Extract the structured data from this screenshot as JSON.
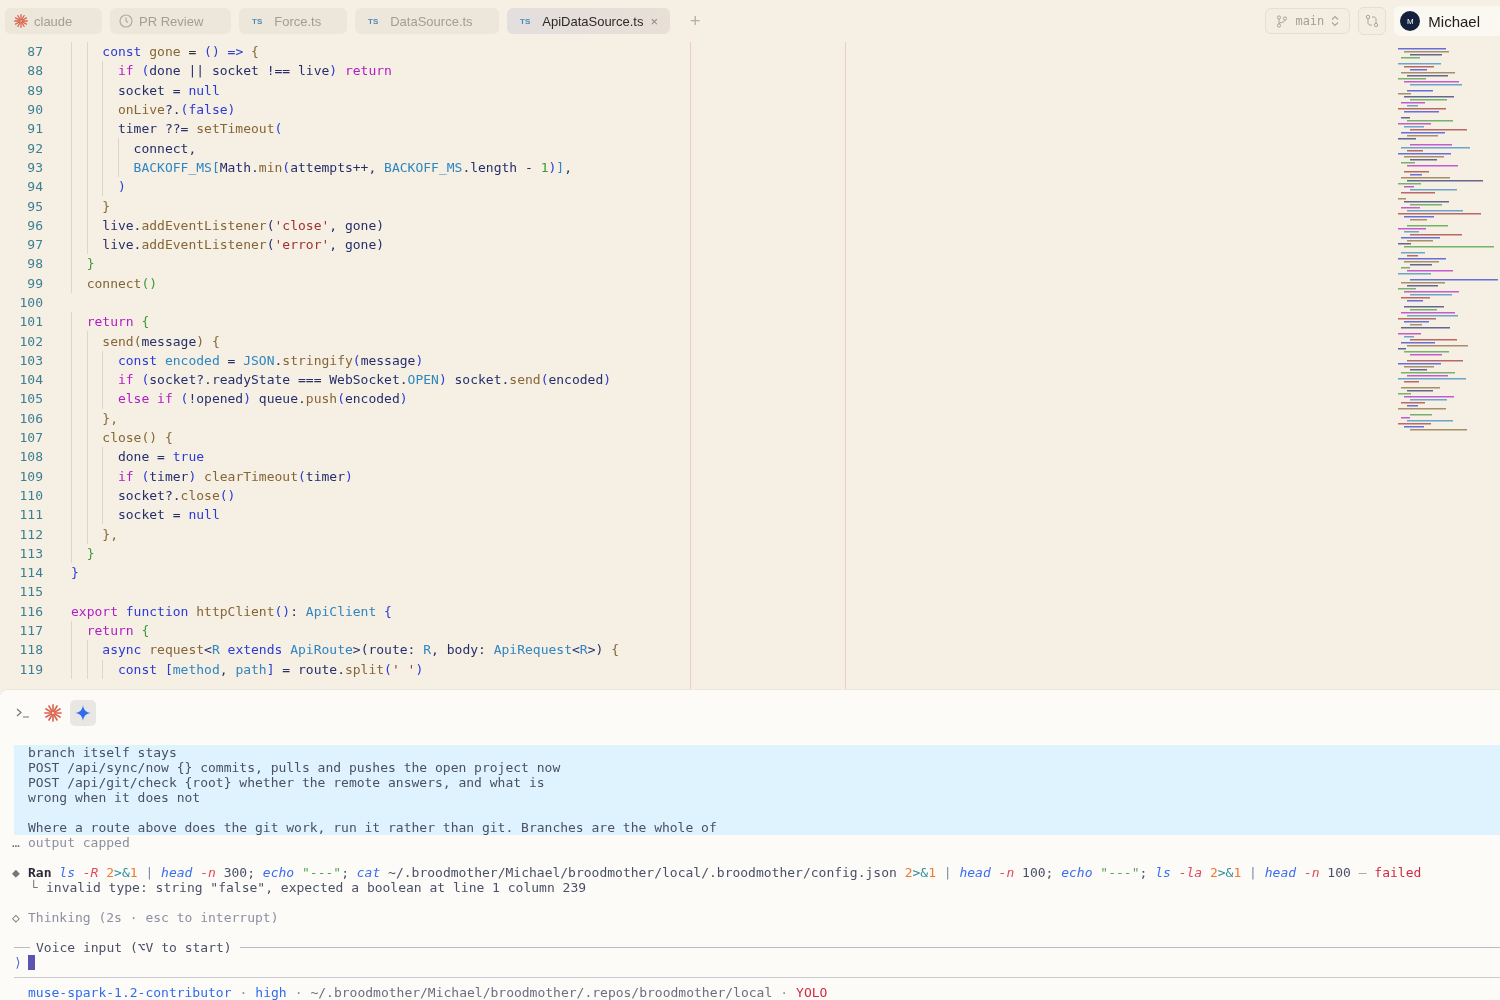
{
  "tabs": [
    {
      "kind": "logo",
      "label": "claude",
      "selected": false
    },
    {
      "kind": "clock",
      "label": "PR Review",
      "selected": false
    },
    {
      "kind": "file",
      "badge": "TS",
      "label": "Force.ts",
      "selected": false
    },
    {
      "kind": "file",
      "badge": "TS",
      "label": "DataSource.ts",
      "selected": false
    },
    {
      "kind": "file",
      "badge": "TS",
      "label": "ApiDataSource.ts",
      "selected": true,
      "close": "×"
    }
  ],
  "new_tab": "+",
  "branch": {
    "label": "main"
  },
  "user": {
    "initial": "M",
    "name": "Michael"
  },
  "editor": {
    "lines": [
      {
        "number": "87",
        "tokens": [
          {
            "kind": "keyword",
            "text": "    const"
          },
          {
            "kind": "function",
            "text": " gone"
          },
          {
            "kind": "plain",
            "text": " = "
          },
          {
            "kind": "paren",
            "text": "()"
          },
          {
            "kind": "keyword",
            "text": " =>"
          },
          {
            "kind": "brace",
            "text": " {"
          }
        ]
      },
      {
        "number": "88",
        "tokens": [
          {
            "kind": "control",
            "text": "      if"
          },
          {
            "kind": "paren",
            "text": " ("
          },
          {
            "kind": "name",
            "text": "done || socket !== live"
          },
          {
            "kind": "paren",
            "text": ")"
          },
          {
            "kind": "control",
            "text": " return"
          }
        ]
      },
      {
        "number": "89",
        "tokens": [
          {
            "kind": "name",
            "text": "      socket = "
          },
          {
            "kind": "keyword",
            "text": "null"
          }
        ]
      },
      {
        "number": "90",
        "tokens": [
          {
            "kind": "function",
            "text": "      onLive"
          },
          {
            "kind": "name",
            "text": "?."
          },
          {
            "kind": "paren",
            "text": "("
          },
          {
            "kind": "keyword",
            "text": "false"
          },
          {
            "kind": "paren",
            "text": ")"
          }
        ]
      },
      {
        "number": "91",
        "tokens": [
          {
            "kind": "name",
            "text": "      timer ??= "
          },
          {
            "kind": "function",
            "text": "setTimeout"
          },
          {
            "kind": "paren",
            "text": "("
          }
        ]
      },
      {
        "number": "92",
        "tokens": [
          {
            "kind": "name",
            "text": "        connect,"
          }
        ]
      },
      {
        "number": "93",
        "tokens": [
          {
            "kind": "type",
            "text": "        BACKOFF_MS["
          },
          {
            "kind": "name",
            "text": "Math."
          },
          {
            "kind": "function",
            "text": "min"
          },
          {
            "kind": "paren",
            "text": "("
          },
          {
            "kind": "name",
            "text": "attempts++, "
          },
          {
            "kind": "type",
            "text": "BACKOFF_MS"
          },
          {
            "kind": "name",
            "text": ".length - "
          },
          {
            "kind": "number",
            "text": "1"
          },
          {
            "kind": "paren",
            "text": ")"
          },
          {
            "kind": "type",
            "text": "]"
          },
          {
            "kind": "name",
            "text": ","
          }
        ]
      },
      {
        "number": "94",
        "tokens": [
          {
            "kind": "paren",
            "text": "      )"
          }
        ]
      },
      {
        "number": "95",
        "tokens": [
          {
            "kind": "brace",
            "text": "    }"
          }
        ]
      },
      {
        "number": "96",
        "tokens": [
          {
            "kind": "name",
            "text": "    live."
          },
          {
            "kind": "function",
            "text": "addEventListener"
          },
          {
            "kind": "name",
            "text": "("
          },
          {
            "kind": "string",
            "text": "'close'"
          },
          {
            "kind": "name",
            "text": ", gone)"
          }
        ]
      },
      {
        "number": "97",
        "tokens": [
          {
            "kind": "name",
            "text": "    live."
          },
          {
            "kind": "function",
            "text": "addEventListener"
          },
          {
            "kind": "name",
            "text": "("
          },
          {
            "kind": "string",
            "text": "'error'"
          },
          {
            "kind": "name",
            "text": ", gone)"
          }
        ]
      },
      {
        "number": "98",
        "tokens": [
          {
            "kind": "bracket",
            "text": "  }"
          }
        ]
      },
      {
        "number": "99",
        "tokens": [
          {
            "kind": "function",
            "text": "  connect"
          },
          {
            "kind": "bracket",
            "text": "()"
          }
        ]
      },
      {
        "number": "100"
      },
      {
        "number": "101",
        "tokens": [
          {
            "kind": "control",
            "text": "  return"
          },
          {
            "kind": "bracket",
            "text": " {"
          }
        ]
      },
      {
        "number": "102",
        "tokens": [
          {
            "kind": "function",
            "text": "    send"
          },
          {
            "kind": "brace",
            "text": "("
          },
          {
            "kind": "name",
            "text": "message"
          },
          {
            "kind": "brace",
            "text": ") {"
          }
        ]
      },
      {
        "number": "103",
        "tokens": [
          {
            "kind": "keyword",
            "text": "      const"
          },
          {
            "kind": "type",
            "text": " encoded"
          },
          {
            "kind": "name",
            "text": " = "
          },
          {
            "kind": "type",
            "text": "JSON"
          },
          {
            "kind": "name",
            "text": "."
          },
          {
            "kind": "function",
            "text": "stringify"
          },
          {
            "kind": "paren",
            "text": "("
          },
          {
            "kind": "name",
            "text": "message"
          },
          {
            "kind": "paren",
            "text": ")"
          }
        ]
      },
      {
        "number": "104",
        "tokens": [
          {
            "kind": "control",
            "text": "      if"
          },
          {
            "kind": "paren",
            "text": " ("
          },
          {
            "kind": "name",
            "text": "socket?.readyState === WebSocket."
          },
          {
            "kind": "type",
            "text": "OPEN"
          },
          {
            "kind": "paren",
            "text": ")"
          },
          {
            "kind": "name",
            "text": " socket."
          },
          {
            "kind": "function",
            "text": "send"
          },
          {
            "kind": "paren",
            "text": "("
          },
          {
            "kind": "name",
            "text": "encoded"
          },
          {
            "kind": "paren",
            "text": ")"
          }
        ]
      },
      {
        "number": "105",
        "tokens": [
          {
            "kind": "control",
            "text": "      else if"
          },
          {
            "kind": "paren",
            "text": " ("
          },
          {
            "kind": "name",
            "text": "!opened"
          },
          {
            "kind": "paren",
            "text": ")"
          },
          {
            "kind": "name",
            "text": " queue."
          },
          {
            "kind": "function",
            "text": "push"
          },
          {
            "kind": "paren",
            "text": "("
          },
          {
            "kind": "name",
            "text": "encoded"
          },
          {
            "kind": "paren",
            "text": ")"
          }
        ]
      },
      {
        "number": "106",
        "tokens": [
          {
            "kind": "brace",
            "text": "    },"
          }
        ]
      },
      {
        "number": "107",
        "tokens": [
          {
            "kind": "function",
            "text": "    close"
          },
          {
            "kind": "brace",
            "text": "() {"
          }
        ]
      },
      {
        "number": "108",
        "tokens": [
          {
            "kind": "name",
            "text": "      done = "
          },
          {
            "kind": "keyword",
            "text": "true"
          }
        ]
      },
      {
        "number": "109",
        "tokens": [
          {
            "kind": "control",
            "text": "      if"
          },
          {
            "kind": "paren",
            "text": " ("
          },
          {
            "kind": "name",
            "text": "timer"
          },
          {
            "kind": "paren",
            "text": ")"
          },
          {
            "kind": "function",
            "text": " clearTimeout"
          },
          {
            "kind": "paren",
            "text": "("
          },
          {
            "kind": "name",
            "text": "timer"
          },
          {
            "kind": "paren",
            "text": ")"
          }
        ]
      },
      {
        "number": "110",
        "tokens": [
          {
            "kind": "name",
            "text": "      socket?."
          },
          {
            "kind": "function",
            "text": "close"
          },
          {
            "kind": "paren",
            "text": "()"
          }
        ]
      },
      {
        "number": "111",
        "tokens": [
          {
            "kind": "name",
            "text": "      socket = "
          },
          {
            "kind": "keyword",
            "text": "null"
          }
        ]
      },
      {
        "number": "112",
        "tokens": [
          {
            "kind": "brace",
            "text": "    },"
          }
        ]
      },
      {
        "number": "113",
        "tokens": [
          {
            "kind": "bracket",
            "text": "  }"
          }
        ]
      },
      {
        "number": "114",
        "tokens": [
          {
            "kind": "paren",
            "text": "}"
          }
        ]
      },
      {
        "number": "115"
      },
      {
        "number": "116",
        "tokens": [
          {
            "kind": "control",
            "text": "export"
          },
          {
            "kind": "keyword",
            "text": " function"
          },
          {
            "kind": "function",
            "text": " httpClient"
          },
          {
            "kind": "paren",
            "text": "()"
          },
          {
            "kind": "name",
            "text": ": "
          },
          {
            "kind": "type",
            "text": "ApiClient"
          },
          {
            "kind": "paren",
            "text": " {"
          }
        ]
      },
      {
        "number": "117",
        "tokens": [
          {
            "kind": "control",
            "text": "  return"
          },
          {
            "kind": "bracket",
            "text": " {"
          }
        ]
      },
      {
        "number": "118",
        "tokens": [
          {
            "kind": "keyword",
            "text": "    async"
          },
          {
            "kind": "function",
            "text": " request"
          },
          {
            "kind": "name",
            "text": "<"
          },
          {
            "kind": "type",
            "text": "R"
          },
          {
            "kind": "keyword",
            "text": " extends"
          },
          {
            "kind": "type",
            "text": " ApiRoute"
          },
          {
            "kind": "name",
            "text": ">(route: "
          },
          {
            "kind": "type",
            "text": "R"
          },
          {
            "kind": "name",
            "text": ", body: "
          },
          {
            "kind": "type",
            "text": "ApiRequest"
          },
          {
            "kind": "name",
            "text": "<"
          },
          {
            "kind": "type",
            "text": "R"
          },
          {
            "kind": "name",
            "text": ">)"
          },
          {
            "kind": "brace",
            "text": " {"
          }
        ]
      },
      {
        "number": "119",
        "tokens": [
          {
            "kind": "keyword",
            "text": "      const"
          },
          {
            "kind": "paren",
            "text": " ["
          },
          {
            "kind": "type",
            "text": "method"
          },
          {
            "kind": "name",
            "text": ", "
          },
          {
            "kind": "type",
            "text": "path"
          },
          {
            "kind": "paren",
            "text": "]"
          },
          {
            "kind": "name",
            "text": " = route."
          },
          {
            "kind": "function",
            "text": "split"
          },
          {
            "kind": "paren",
            "text": "("
          },
          {
            "kind": "string",
            "text": "' '"
          },
          {
            "kind": "paren",
            "text": ")"
          }
        ]
      }
    ]
  },
  "terminal": {
    "tools": [
      {
        "kind": "prompt",
        "selected": false
      },
      {
        "kind": "asterisk",
        "selected": false
      },
      {
        "kind": "sparkle",
        "selected": true
      }
    ],
    "output_block": [
      [
        "branch itself stays",
        "POST /api/sync/now {} commits, pulls and pushes the open project now",
        "POST /api/git/check {root} whether the remote answers, and what is",
        "wrong when it does not"
      ],
      [
        "Where a route above does the git work, run it rather than git. Branches are the whole of"
      ]
    ],
    "capped": {
      "mark": "…",
      "text": "output capped"
    },
    "command": {
      "bullet": "◆",
      "tokens": [
        {
          "kind": "bold",
          "text": "Ran "
        },
        {
          "kind": "command",
          "text": "ls"
        },
        {
          "kind": "flag",
          "text": " -R"
        },
        {
          "kind": "digit",
          "text": " 2"
        },
        {
          "kind": "operator",
          "text": ">&"
        },
        {
          "kind": "digit",
          "text": "1"
        },
        {
          "kind": "pipe",
          "text": " |"
        },
        {
          "kind": "command",
          "text": " head"
        },
        {
          "kind": "flag",
          "text": " -n"
        },
        {
          "kind": "plain",
          "text": " 300; "
        },
        {
          "kind": "command",
          "text": "echo"
        },
        {
          "kind": "string",
          "text": " \"---\""
        },
        {
          "kind": "plain",
          "text": "; "
        },
        {
          "kind": "command",
          "text": "cat"
        },
        {
          "kind": "plain",
          "text": " ~/.broodmother/Michael/broodmother/local/.broodmother/config.json "
        },
        {
          "kind": "digit",
          "text": "2"
        },
        {
          "kind": "operator",
          "text": ">&"
        },
        {
          "kind": "digit",
          "text": "1"
        },
        {
          "kind": "pipe",
          "text": " |"
        },
        {
          "kind": "command",
          "text": " head"
        },
        {
          "kind": "flag",
          "text": " -n"
        },
        {
          "kind": "plain",
          "text": " 100; "
        },
        {
          "kind": "command",
          "text": "echo"
        },
        {
          "kind": "string",
          "text": " \"---\""
        },
        {
          "kind": "plain",
          "text": "; "
        },
        {
          "kind": "command",
          "text": "ls"
        },
        {
          "kind": "flag",
          "text": " -la"
        },
        {
          "kind": "digit",
          "text": " 2"
        },
        {
          "kind": "operator",
          "text": ">&"
        },
        {
          "kind": "digit",
          "text": "1"
        },
        {
          "kind": "pipe",
          "text": " |"
        },
        {
          "kind": "command",
          "text": " head"
        },
        {
          "kind": "flag",
          "text": " -n"
        },
        {
          "kind": "plain",
          "text": " 100 "
        },
        {
          "kind": "dash",
          "text": "—"
        },
        {
          "kind": "failure",
          "text": " failed"
        }
      ],
      "result_mark": "└",
      "result": "invalid type: string \"false\", expected a boolean at line 1 column 239"
    },
    "thinking": {
      "bullet": "◇",
      "text": "Thinking (2s · esc to interrupt)"
    },
    "voice": "Voice input (⌥V to start)",
    "prompt": "⟩",
    "status": [
      {
        "kind": "model",
        "text": "muse-spark-1.2-contributor"
      },
      {
        "kind": "sep",
        "text": "·"
      },
      {
        "kind": "effort",
        "text": "high"
      },
      {
        "kind": "sep",
        "text": "·"
      },
      {
        "kind": "path",
        "text": "~/.broodmother/Michael/broodmother/.repos/broodmother/local"
      },
      {
        "kind": "sep",
        "text": "·"
      },
      {
        "kind": "mode",
        "text": "YOLO"
      }
    ]
  }
}
